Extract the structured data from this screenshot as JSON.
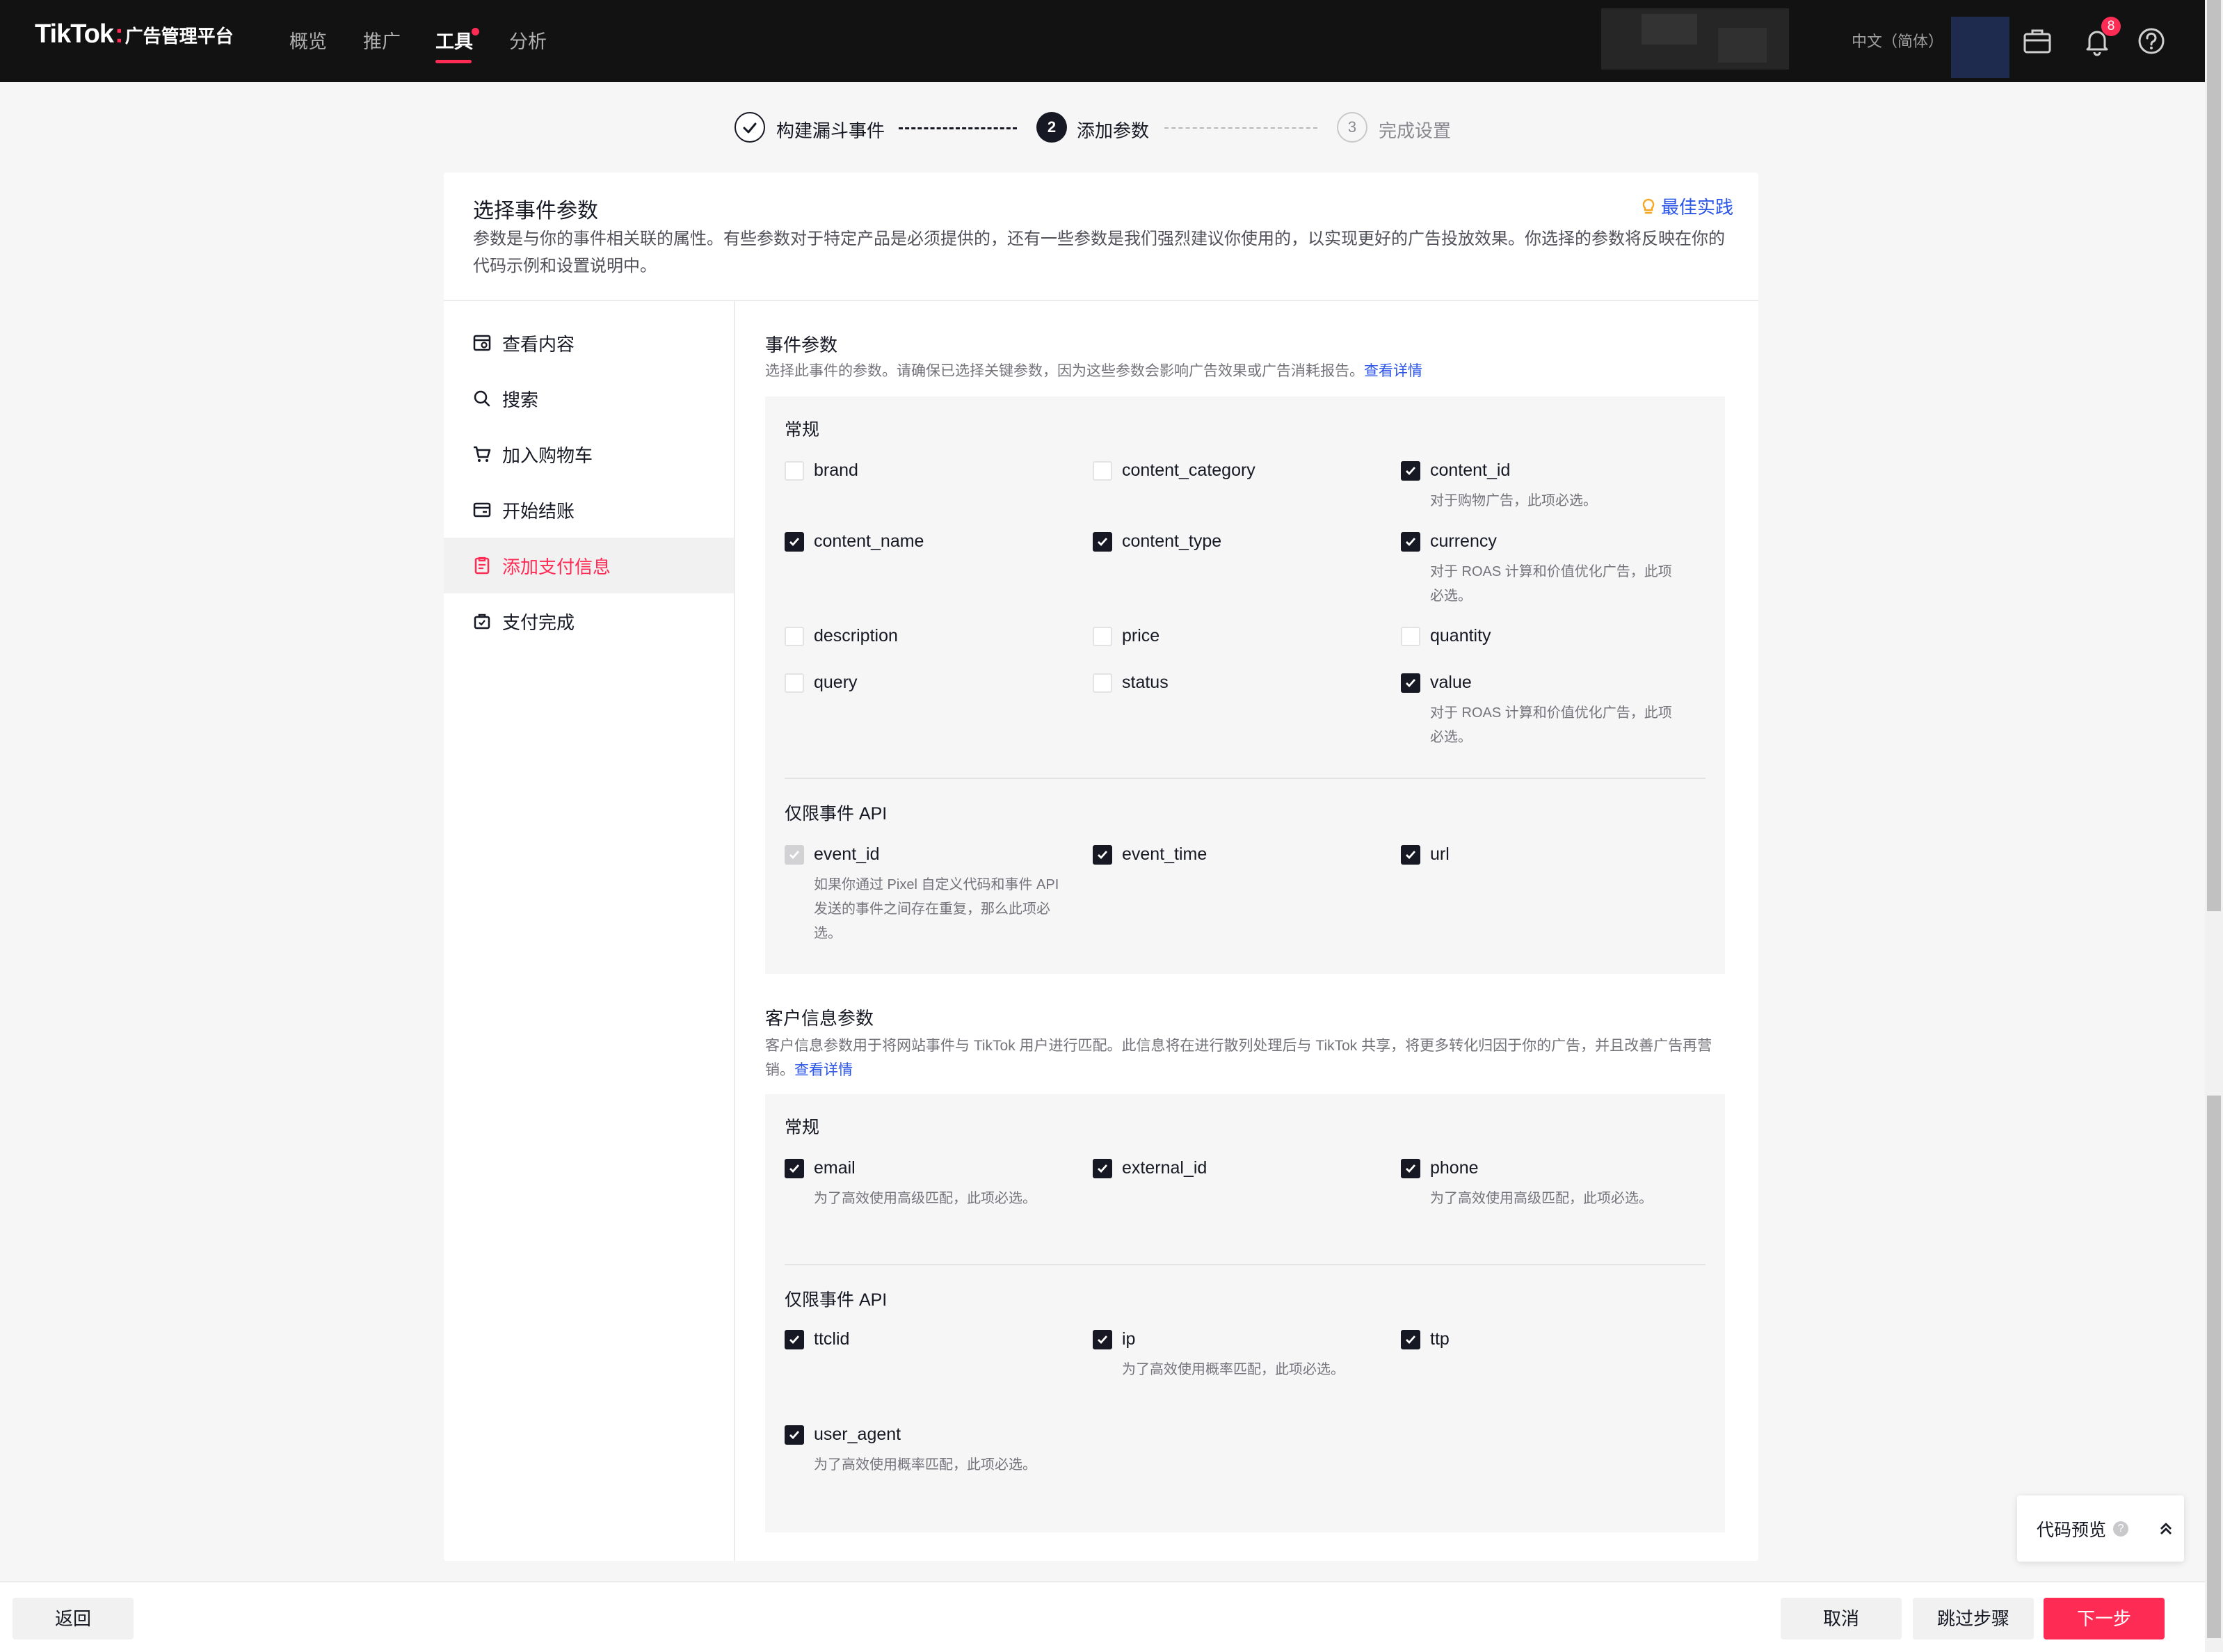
{
  "topnav": {
    "logo_brand": "TikTok",
    "logo_colon": ":",
    "logo_sub": "广告管理平台",
    "items": [
      "概览",
      "推广",
      "工具",
      "分析"
    ],
    "active_index": 2,
    "language": "中文（简体）",
    "notification_count": "8"
  },
  "stepper": {
    "steps": [
      {
        "number": "1",
        "label": "构建漏斗事件",
        "state": "done"
      },
      {
        "number": "2",
        "label": "添加参数",
        "state": "active"
      },
      {
        "number": "3",
        "label": "完成设置",
        "state": "pending"
      }
    ]
  },
  "card": {
    "title": "选择事件参数",
    "best_practice": "最佳实践",
    "description": "参数是与你的事件相关联的属性。有些参数对于特定产品是必须提供的，还有一些参数是我们强烈建议你使用的，以实现更好的广告投放效果。你选择的参数将反映在你的代码示例和设置说明中。"
  },
  "sidebar": {
    "items": [
      {
        "label": "查看内容",
        "icon": "view-content-icon"
      },
      {
        "label": "搜索",
        "icon": "search-icon"
      },
      {
        "label": "加入购物车",
        "icon": "cart-icon"
      },
      {
        "label": "开始结账",
        "icon": "checkout-icon"
      },
      {
        "label": "添加支付信息",
        "icon": "payment-info-icon"
      },
      {
        "label": "支付完成",
        "icon": "complete-payment-icon"
      }
    ],
    "active_index": 4
  },
  "event_params": {
    "title": "事件参数",
    "description": "选择此事件的参数。请确保已选择关键参数，因为这些参数会影响广告效果或广告消耗报告。",
    "link": "查看详情",
    "general": {
      "title": "常规",
      "options": [
        {
          "name": "brand",
          "checked": false
        },
        {
          "name": "content_category",
          "checked": false
        },
        {
          "name": "content_id",
          "checked": true,
          "hint": "对于购物广告，此项必选。"
        },
        {
          "name": "content_name",
          "checked": true
        },
        {
          "name": "content_type",
          "checked": true
        },
        {
          "name": "currency",
          "checked": true,
          "hint": "对于 ROAS 计算和价值优化广告，此项必选。"
        },
        {
          "name": "description",
          "checked": false
        },
        {
          "name": "price",
          "checked": false
        },
        {
          "name": "quantity",
          "checked": false
        },
        {
          "name": "query",
          "checked": false
        },
        {
          "name": "status",
          "checked": false
        },
        {
          "name": "value",
          "checked": true,
          "hint": "对于 ROAS 计算和价值优化广告，此项必选。"
        }
      ]
    },
    "api_only": {
      "title": "仅限事件 API",
      "options": [
        {
          "name": "event_id",
          "checked": true,
          "disabled": true,
          "hint": "如果你通过 Pixel 自定义代码和事件 API 发送的事件之间存在重复，那么此项必选。"
        },
        {
          "name": "event_time",
          "checked": true
        },
        {
          "name": "url",
          "checked": true
        }
      ]
    }
  },
  "customer_params": {
    "title": "客户信息参数",
    "description": "客户信息参数用于将网站事件与 TikTok 用户进行匹配。此信息将在进行散列处理后与 TikTok 共享，将更多转化归因于你的广告，并且改善广告再营销。",
    "link": "查看详情",
    "general": {
      "title": "常规",
      "options": [
        {
          "name": "email",
          "checked": true,
          "hint": "为了高效使用高级匹配，此项必选。"
        },
        {
          "name": "external_id",
          "checked": true
        },
        {
          "name": "phone",
          "checked": true,
          "hint": "为了高效使用高级匹配，此项必选。"
        }
      ]
    },
    "api_only": {
      "title": "仅限事件 API",
      "options": [
        {
          "name": "ttclid",
          "checked": true
        },
        {
          "name": "ip",
          "checked": true,
          "hint": "为了高效使用概率匹配，此项必选。"
        },
        {
          "name": "ttp",
          "checked": true
        },
        {
          "name": "user_agent",
          "checked": true,
          "hint": "为了高效使用概率匹配，此项必选。"
        }
      ]
    }
  },
  "code_preview": {
    "label": "代码预览",
    "help": "?"
  },
  "footer": {
    "back": "返回",
    "cancel": "取消",
    "skip": "跳过步骤",
    "next": "下一步"
  },
  "colors": {
    "brand": "#fe2c55",
    "link": "#2b56e6",
    "nav_bg": "#121212"
  }
}
